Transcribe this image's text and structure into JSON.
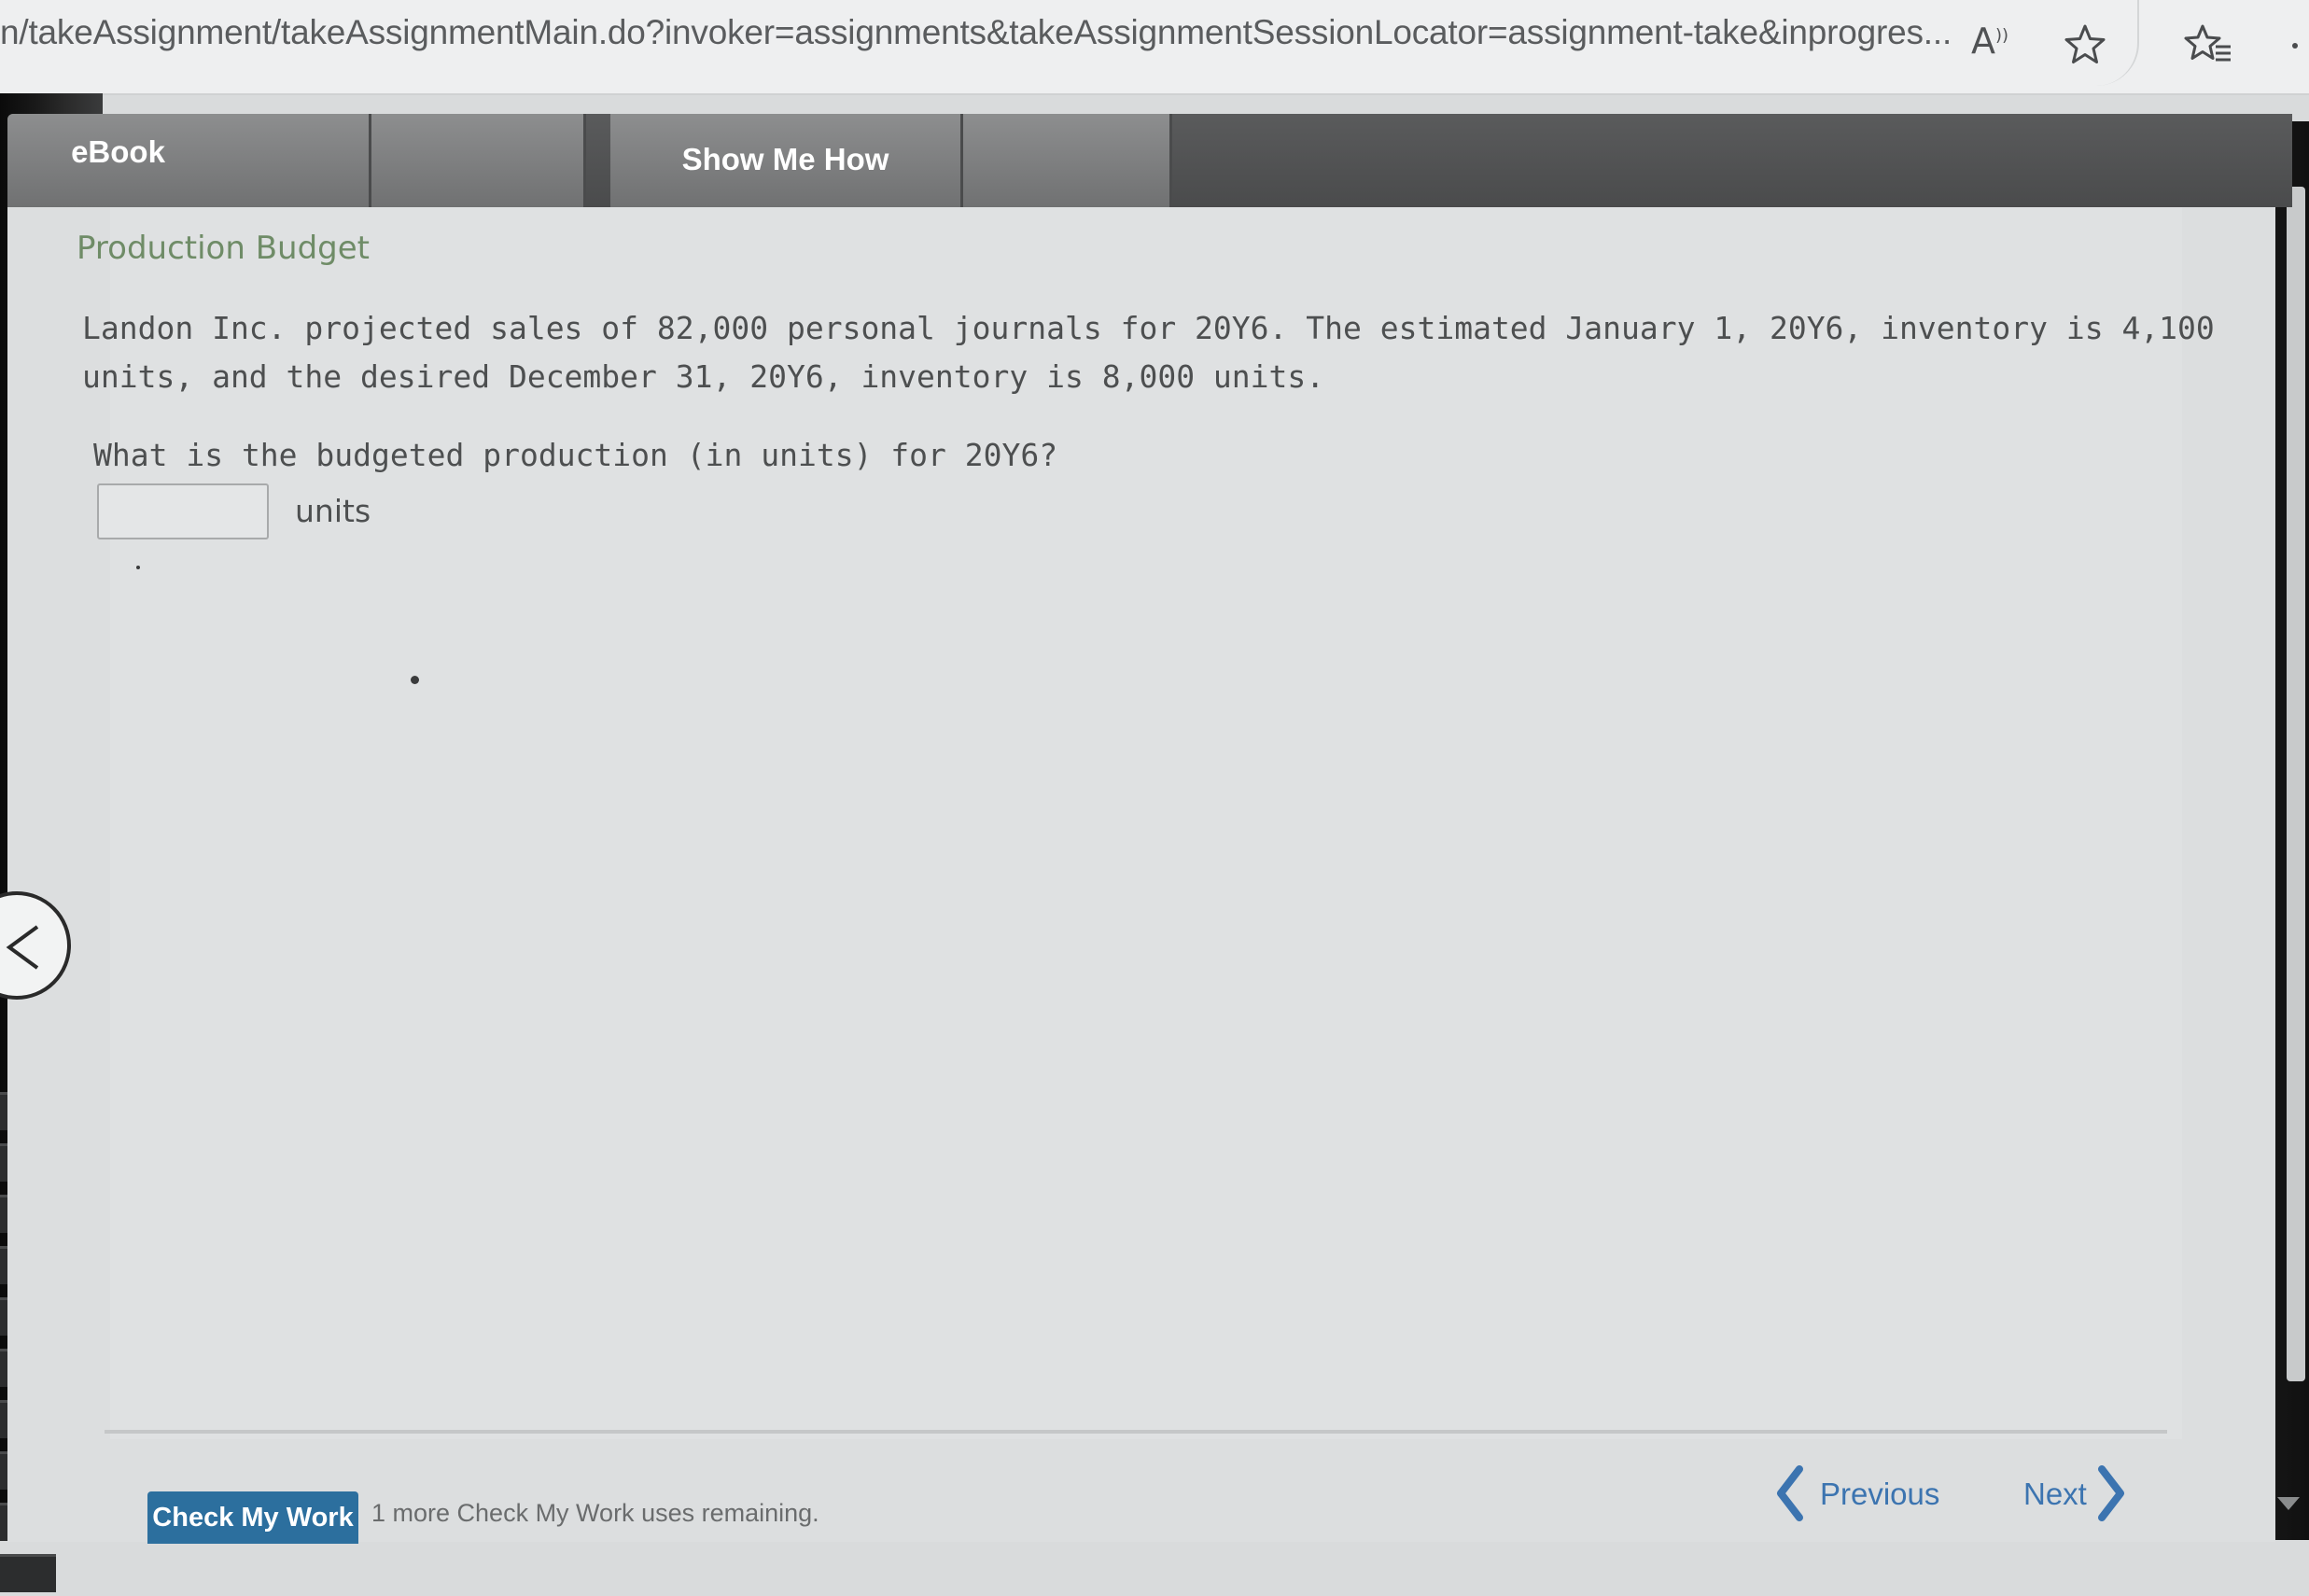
{
  "browser": {
    "url": "n/takeAssignment/takeAssignmentMain.do?invoker=assignments&takeAssignmentSessionLocator=assignment-take&inprogres...",
    "read_aloud_label": "A",
    "icons": [
      "read-aloud-icon",
      "star-icon",
      "favorites-icon",
      "more-icon"
    ]
  },
  "toolbar": {
    "ebook_label": "eBook",
    "show_me_how_label": "Show Me How"
  },
  "problem": {
    "title": "Production Budget",
    "body": "Landon Inc. projected sales of 82,000 personal journals for 20Y6. The estimated January 1, 20Y6, inventory is 4,100 units, and the desired December 31, 20Y6, inventory is 8,000 units.",
    "question": "What is the budgeted production (in units) for 20Y6?",
    "answer_value": "",
    "answer_units": "units"
  },
  "footer": {
    "check_my_work_label": "Check My Work",
    "remaining_text": "1 more Check My Work uses remaining.",
    "previous_label": "Previous",
    "next_label": "Next"
  },
  "colors": {
    "title_green": "#6f8c67",
    "link_blue": "#3c74b0",
    "button_blue": "#2c6f9e",
    "toolbar_gray": "#707172"
  }
}
